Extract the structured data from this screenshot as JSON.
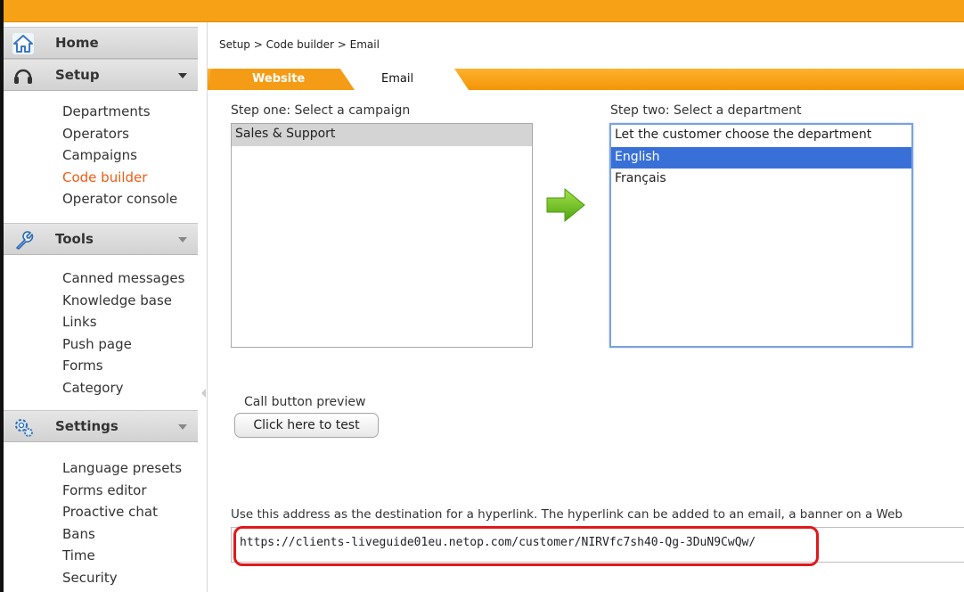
{
  "sidebar": {
    "home": {
      "label": "Home",
      "icon": "home-icon"
    },
    "setup": {
      "label": "Setup",
      "icon": "headset-icon",
      "items": [
        "Departments",
        "Operators",
        "Campaigns",
        "Code builder",
        "Operator console"
      ],
      "active_item": "Code builder"
    },
    "tools": {
      "label": "Tools",
      "icon": "wrench-icon",
      "items": [
        "Canned messages",
        "Knowledge base",
        "Links",
        "Push page",
        "Forms",
        "Category"
      ]
    },
    "settings": {
      "label": "Settings",
      "icon": "gears-icon",
      "items": [
        "Language presets",
        "Forms editor",
        "Proactive chat",
        "Bans",
        "Time",
        "Security"
      ]
    }
  },
  "breadcrumb": "Setup > Code builder > Email",
  "tabs": [
    {
      "label": "Website",
      "active": false
    },
    {
      "label": "Email",
      "active": true
    }
  ],
  "step_one": {
    "label": "Step one: Select a campaign",
    "options": [
      "Sales & Support"
    ],
    "selected": "Sales & Support"
  },
  "step_two": {
    "label": "Step two: Select a department",
    "options": [
      "Let the customer choose the department",
      "English",
      "Français"
    ],
    "selected": "English"
  },
  "preview": {
    "label": "Call button preview",
    "button_label": "Click here to test"
  },
  "instructions": "Use this address as the destination for a hyperlink. The hyperlink can be added to an email, a banner on a Web",
  "url": "https://clients-liveguide01eu.netop.com/customer/NIRVfc7sh40-Qg-3DuN9CwQw/",
  "colors": {
    "accent_orange": "#f7a117",
    "active_nav": "#ef5b14",
    "selected_blue": "#3870d8",
    "arrow_green": "#6cc41a",
    "highlight_red": "#e0191c"
  }
}
